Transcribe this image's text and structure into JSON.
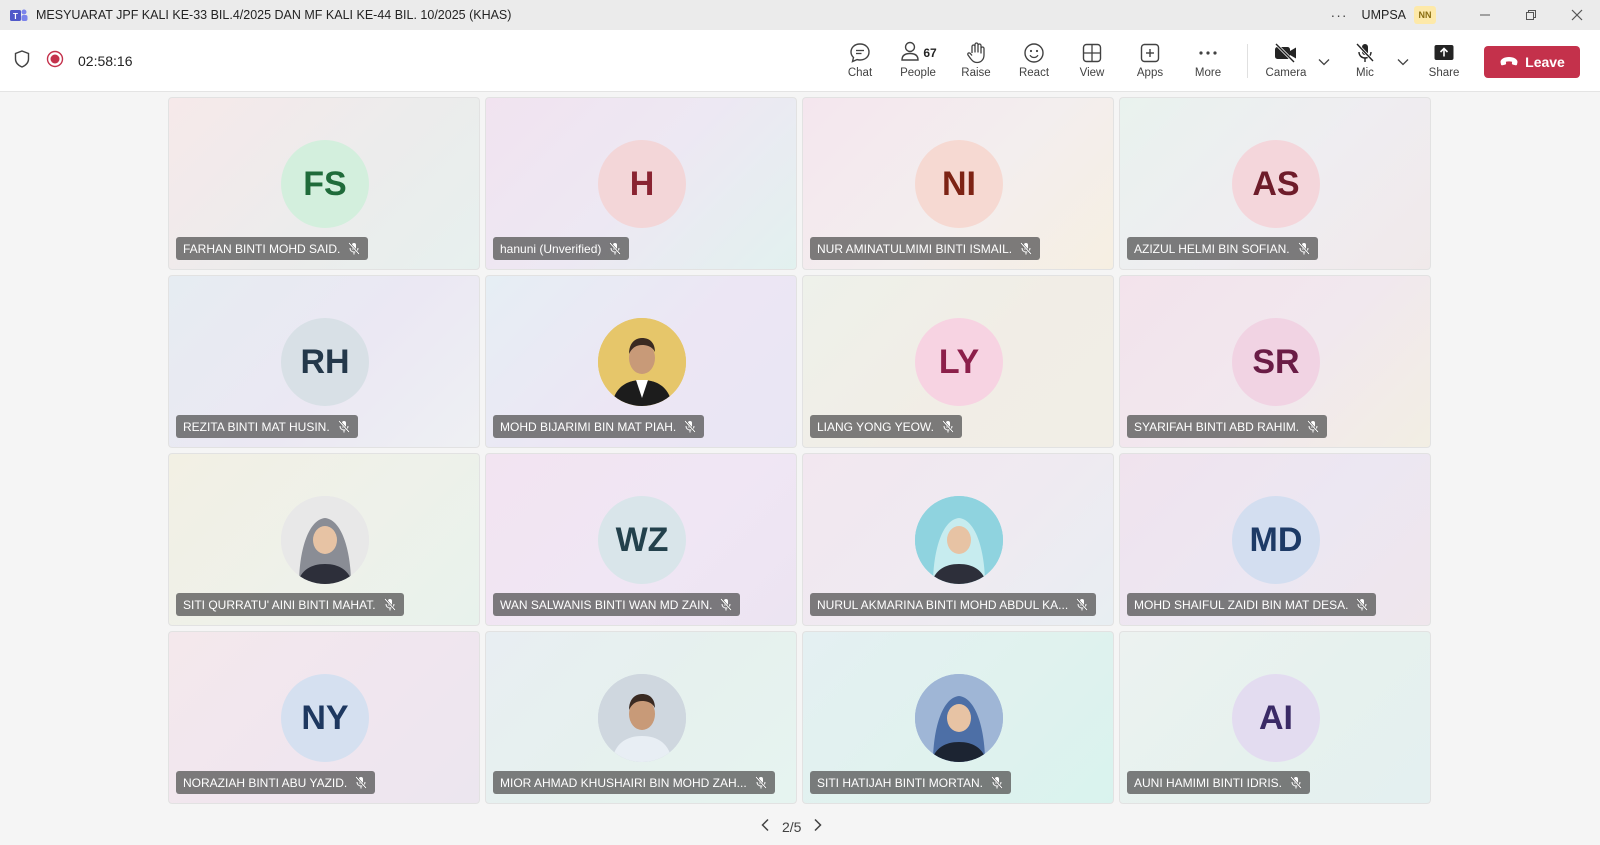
{
  "window": {
    "title": "MESYUARAT JPF KALI KE-33 BIL.4/2025 DAN MF KALI KE-44 BIL. 10/2025 (KHAS)",
    "more": "···",
    "org": "UMPSA",
    "org_badge": "NN"
  },
  "toolbar": {
    "timer": "02:58:16",
    "chat": "Chat",
    "people": "People",
    "people_count": "67",
    "raise": "Raise",
    "react": "React",
    "view": "View",
    "apps": "Apps",
    "more": "More",
    "camera": "Camera",
    "mic": "Mic",
    "share": "Share",
    "leave": "Leave",
    "accent": "#c4314b"
  },
  "participants": [
    {
      "name": "FARHAN BINTI MOHD SAID.",
      "initials": "FS",
      "avatar_bg": "#d3efdd",
      "initials_color": "#1f6b3a",
      "photo": false
    },
    {
      "name": "hanuni (Unverified)",
      "initials": "H",
      "avatar_bg": "#f3d6d8",
      "initials_color": "#8a2432",
      "photo": false
    },
    {
      "name": "NUR AMINATULMIMI BINTI ISMAIL.",
      "initials": "NI",
      "avatar_bg": "#f6d9d2",
      "initials_color": "#7d2314",
      "photo": false
    },
    {
      "name": "AZIZUL HELMI BIN SOFIAN.",
      "initials": "AS",
      "avatar_bg": "#f4d6db",
      "initials_color": "#6e1c2a",
      "photo": false
    },
    {
      "name": "REZITA BINTI MAT HUSIN.",
      "initials": "RH",
      "avatar_bg": "#d8e0e6",
      "initials_color": "#24384a",
      "photo": false
    },
    {
      "name": "MOHD BIJARIMI BIN MAT PIAH.",
      "initials": "",
      "avatar_bg": "#e6c66a",
      "initials_color": "#000000",
      "photo": true
    },
    {
      "name": "LIANG YONG YEOW.",
      "initials": "LY",
      "avatar_bg": "#f7d3e2",
      "initials_color": "#8c1f4a",
      "photo": false
    },
    {
      "name": "SYARIFAH BINTI ABD RAHIM.",
      "initials": "SR",
      "avatar_bg": "#f1d3e3",
      "initials_color": "#6a1c46",
      "photo": false
    },
    {
      "name": "SITI QURRATU' AINI BINTI MAHAT.",
      "initials": "",
      "avatar_bg": "#e8e8e8",
      "initials_color": "#000000",
      "photo": true
    },
    {
      "name": "WAN SALWANIS BINTI WAN MD ZAIN.",
      "initials": "WZ",
      "avatar_bg": "#d9e5ea",
      "initials_color": "#23414c",
      "photo": false
    },
    {
      "name": "NURUL AKMARINA BINTI MOHD ABDUL KA...",
      "initials": "",
      "avatar_bg": "#8fd3df",
      "initials_color": "#000000",
      "photo": true
    },
    {
      "name": "MOHD SHAIFUL ZAIDI BIN MAT DESA.",
      "initials": "MD",
      "avatar_bg": "#d3def0",
      "initials_color": "#1d3a66",
      "photo": false
    },
    {
      "name": "NORAZIAH BINTI ABU YAZID.",
      "initials": "NY",
      "avatar_bg": "#d5e0f0",
      "initials_color": "#1e3860",
      "photo": false
    },
    {
      "name": "MIOR AHMAD KHUSHAIRI BIN MOHD ZAH...",
      "initials": "",
      "avatar_bg": "#cfd7df",
      "initials_color": "#000000",
      "photo": true
    },
    {
      "name": "SITI HATIJAH BINTI MORTAN.",
      "initials": "",
      "avatar_bg": "#9fb6d6",
      "initials_color": "#000000",
      "photo": true
    },
    {
      "name": "AUNI HAMIMI BINTI IDRIS.",
      "initials": "AI",
      "avatar_bg": "#e3dcf0",
      "initials_color": "#3a2a66",
      "photo": false
    }
  ],
  "pager": {
    "label": "2/5"
  }
}
